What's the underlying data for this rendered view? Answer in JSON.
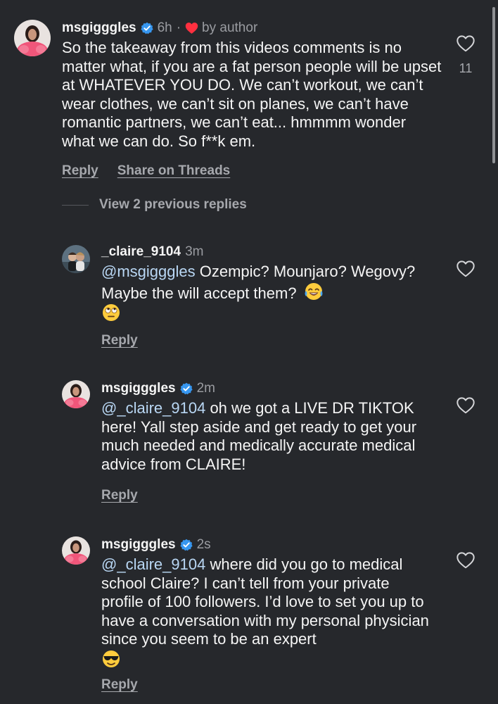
{
  "comments": [
    {
      "username": "msgigggles",
      "verified": true,
      "time": "6h",
      "separator": "·",
      "author_like_label": "by author",
      "text": "So the takeaway from this videos comments is no matter what, if you are a fat person people will be upset at WHATEVER YOU DO. We can’t workout, we can’t wear clothes, we can’t sit on planes, we can’t have romantic partners, we can’t eat... hmmmm wonder what we can do. So f**k em.",
      "reply_label": "Reply",
      "share_label": "Share on Threads",
      "like_count": "11"
    }
  ],
  "view_replies_label": "View 2 previous replies",
  "replies": [
    {
      "username": "_claire_9104",
      "verified": false,
      "time": "3m",
      "mention": "@msgigggles",
      "text": " Ozempic? Mounjaro? Wegovy? Maybe the will accept them?",
      "emojis": [
        "face-with-tears-of-joy",
        "face-with-rolling-eyes"
      ],
      "reply_label": "Reply"
    },
    {
      "username": "msgigggles",
      "verified": true,
      "time": "2m",
      "mention": "@_claire_9104",
      "text": " oh we got a LIVE DR TIKTOK here! Yall step aside and get ready to get your much needed and medically accurate medical advice from CLAIRE!",
      "reply_label": "Reply"
    },
    {
      "username": "msgigggles",
      "verified": true,
      "time": "2s",
      "mention": "@_claire_9104",
      "text": " where did you go to medical school Claire? I can’t tell from your private profile of 100 followers. I’d love to set you up to have a conversation with my personal physician since you seem to be an expert",
      "emojis": [
        "smiling-face-with-sunglasses"
      ],
      "reply_label": "Reply"
    }
  ],
  "colors": {
    "background": "#26282c",
    "text": "#f5f5f5",
    "muted": "#9a9ca1",
    "mention": "#b9d7f4",
    "verified": "#3797f0",
    "author_heart": "#ff3040"
  }
}
